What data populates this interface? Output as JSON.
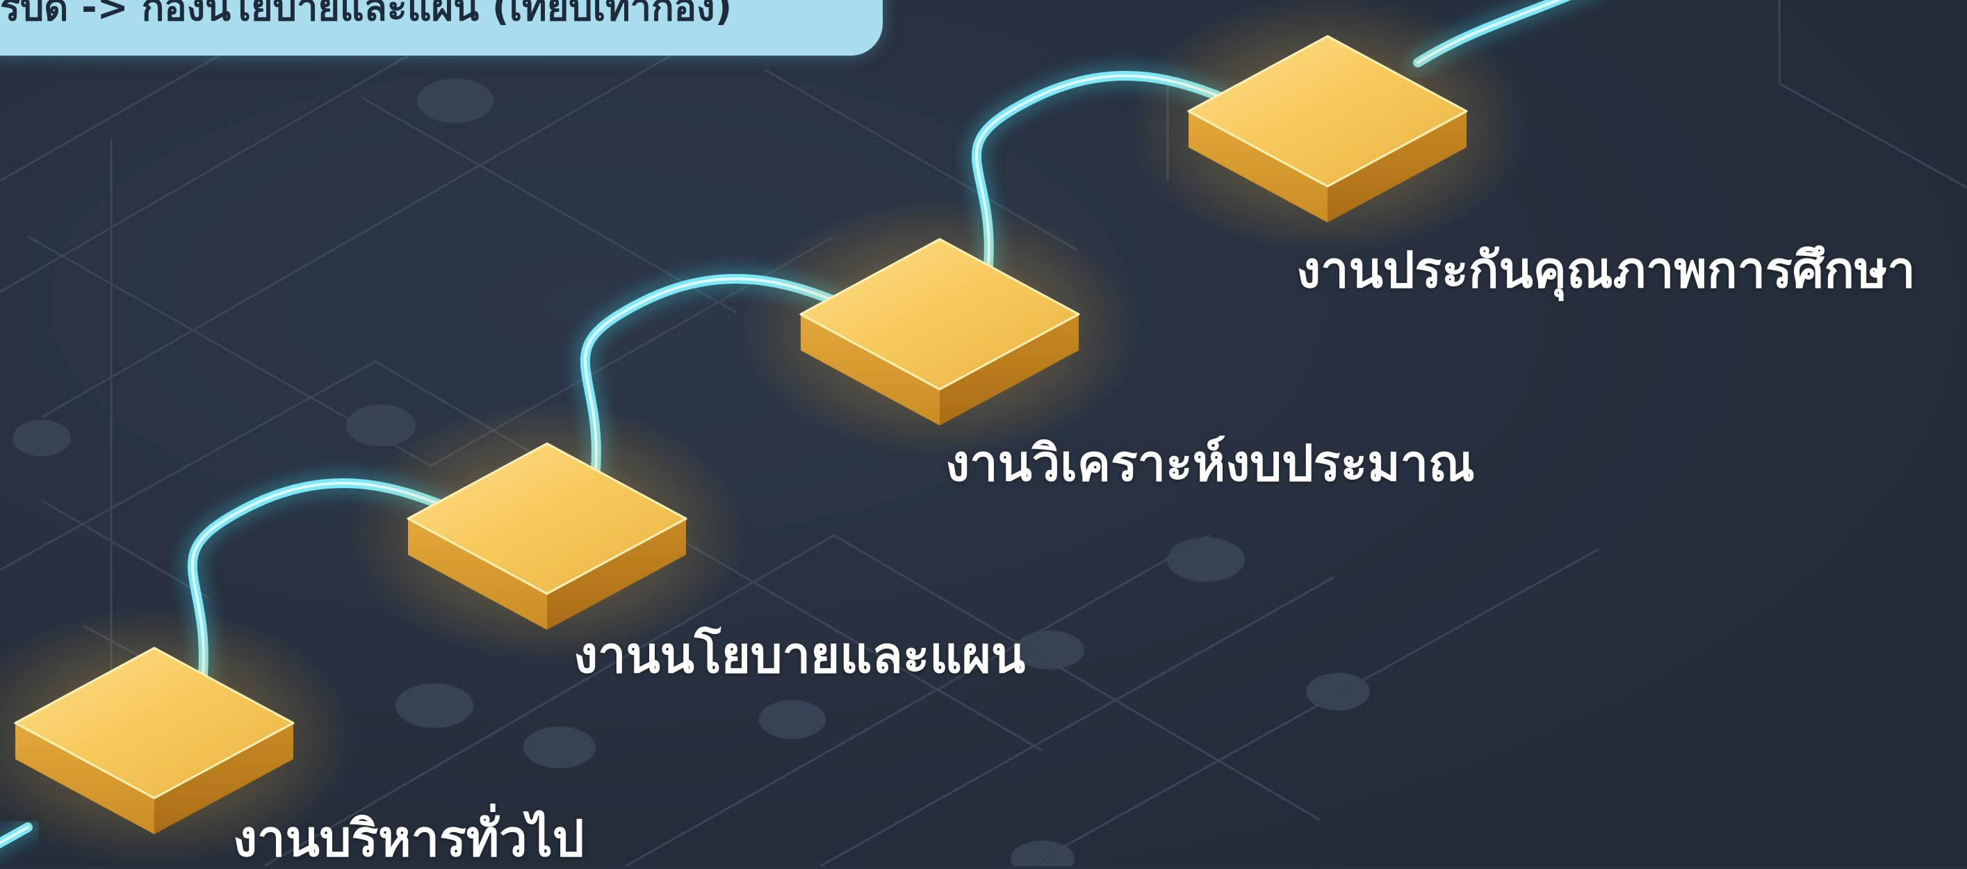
{
  "header": {
    "text": "รบด -> กองนโยบายและแผน (เทียบเท่ากอง)"
  },
  "steps": [
    {
      "label": "งานบริหารทั่วไป"
    },
    {
      "label": "งานนโยบายและแผน"
    },
    {
      "label": "งานวิเคราะห์งบประมาณ"
    },
    {
      "label": "งานประกันคุณภาพการศึกษา"
    }
  ],
  "colors": {
    "background": "#27313f",
    "header_pill": "#a9ddee",
    "block_top": "#f6c85a",
    "block_left": "#d99a2b",
    "block_right": "#b87a1c",
    "connector": "#5fe0f0"
  },
  "icons": [
    "gold-block-icon",
    "circuit-background"
  ]
}
